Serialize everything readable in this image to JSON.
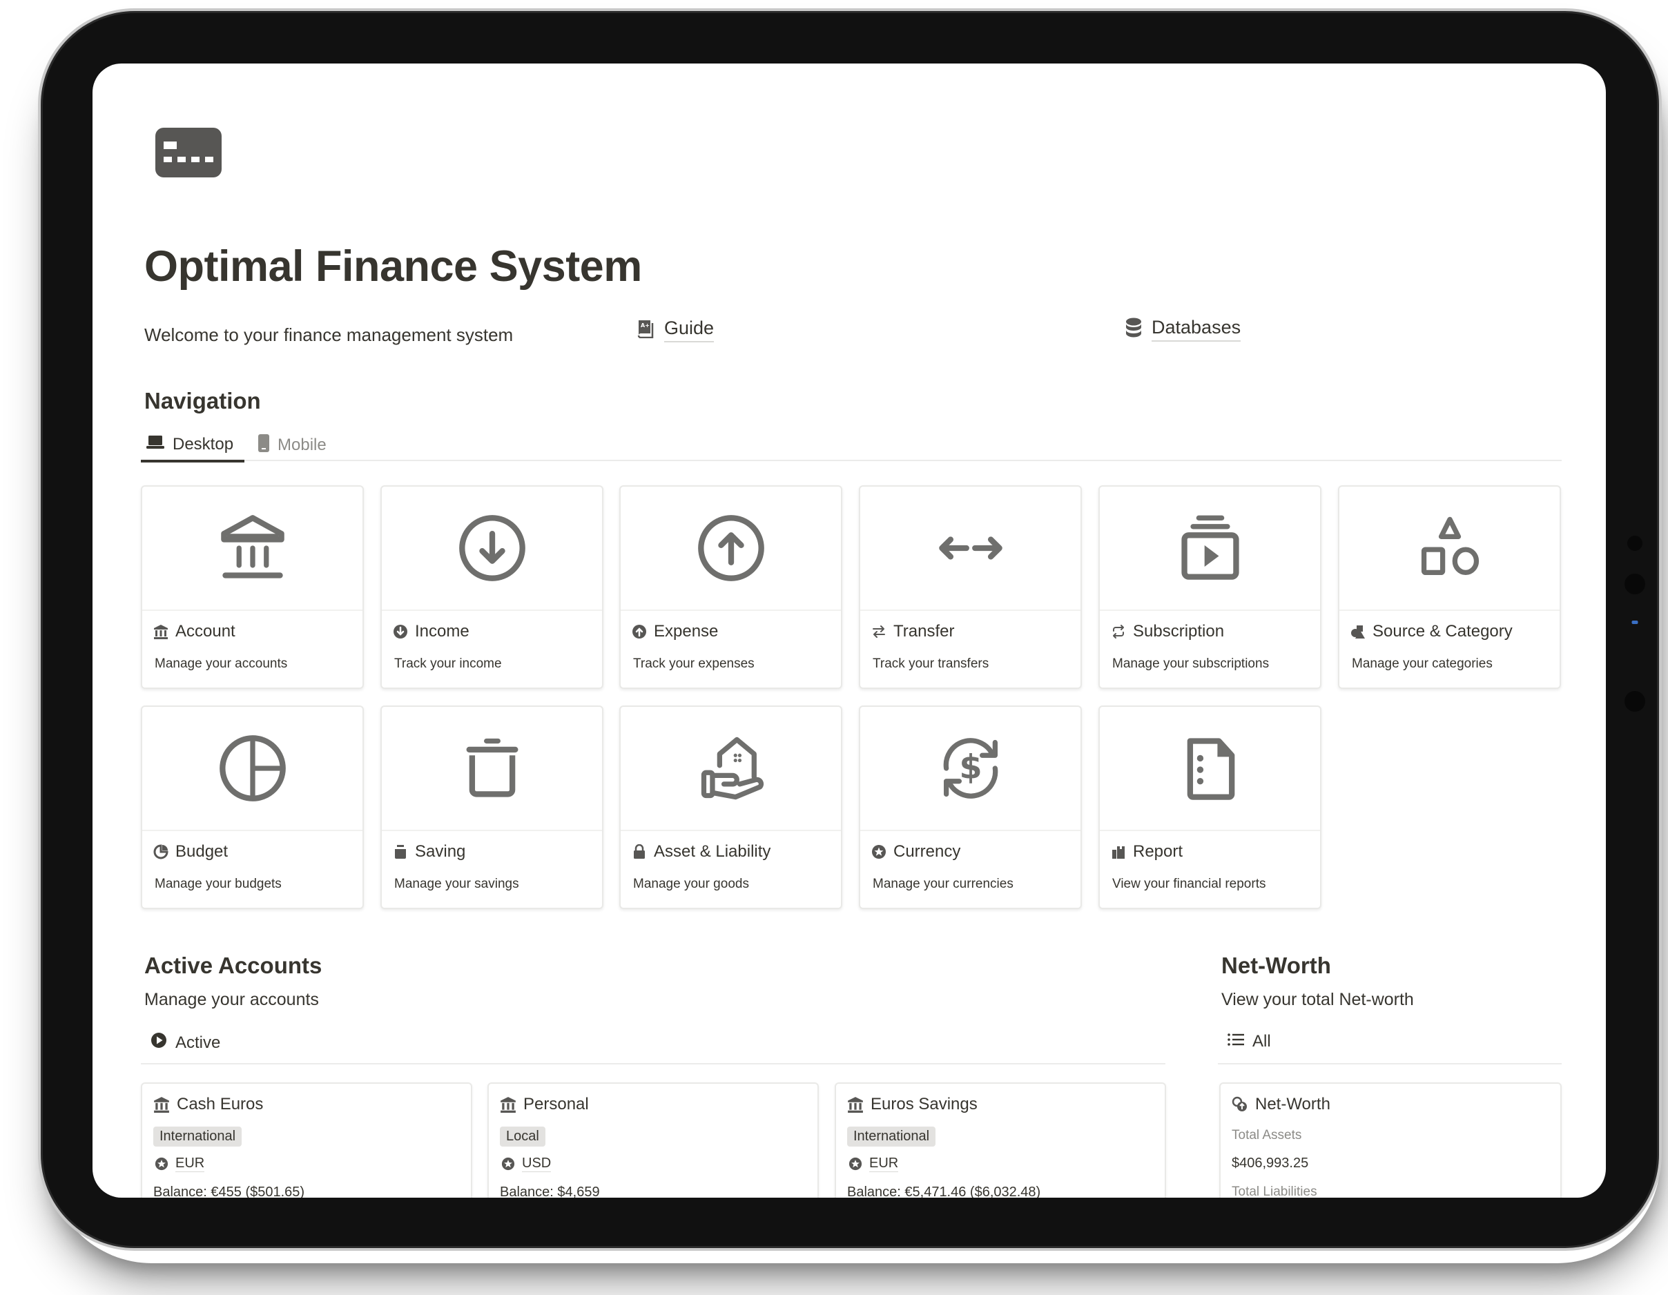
{
  "page": {
    "title": "Optimal Finance System",
    "welcome": "Welcome to your finance management system",
    "links": {
      "guide": "Guide",
      "databases": "Databases"
    }
  },
  "navigation": {
    "heading": "Navigation",
    "tabs": [
      {
        "label": "Desktop",
        "icon": "laptop-icon",
        "active": true
      },
      {
        "label": "Mobile",
        "icon": "phone-icon",
        "active": false
      }
    ],
    "cards": [
      {
        "name": "Account",
        "desc": "Manage your accounts",
        "icon": "bank-icon"
      },
      {
        "name": "Income",
        "desc": "Track your income",
        "icon": "arrow-down-circle-icon"
      },
      {
        "name": "Expense",
        "desc": "Track your expenses",
        "icon": "arrow-up-circle-icon"
      },
      {
        "name": "Transfer",
        "desc": "Track your transfers",
        "icon": "arrows-left-right-icon"
      },
      {
        "name": "Subscription",
        "desc": "Manage your subscriptions",
        "icon": "play-stack-icon"
      },
      {
        "name": "Source & Category",
        "desc": "Manage your categories",
        "icon": "shapes-icon"
      },
      {
        "name": "Budget",
        "desc": "Manage your budgets",
        "icon": "pie-chart-icon"
      },
      {
        "name": "Saving",
        "desc": "Manage your savings",
        "icon": "jar-icon"
      },
      {
        "name": "Asset & Liability",
        "desc": "Manage your goods",
        "icon": "hand-house-icon"
      },
      {
        "name": "Currency",
        "desc": "Manage your currencies",
        "icon": "currency-exchange-icon"
      },
      {
        "name": "Report",
        "desc": "View your financial reports",
        "icon": "document-icon"
      }
    ]
  },
  "active_accounts": {
    "heading": "Active Accounts",
    "subtitle": "Manage your accounts",
    "view": "Active",
    "accounts": [
      {
        "name": "Cash Euros",
        "type": "International",
        "currency": "EUR",
        "balance": "Balance: €455 ($501.65)"
      },
      {
        "name": "Personal",
        "type": "Local",
        "currency": "USD",
        "balance": "Balance: $4,659"
      },
      {
        "name": "Euros Savings",
        "type": "International",
        "currency": "EUR",
        "balance": "Balance: €5,471.46 ($6,032.48)"
      }
    ]
  },
  "net_worth": {
    "heading": "Net-Worth",
    "subtitle": "View your total Net-worth",
    "view": "All",
    "card": {
      "name": "Net-Worth",
      "total_assets_label": "Total Assets",
      "total_assets_value": "$406,993.25",
      "total_liabilities_label": "Total Liabilities"
    }
  },
  "colors": {
    "text": "#37352f",
    "muted": "#8c8b87",
    "icon": "#6f6f6d",
    "tag_bg": "#e3e2e0",
    "bezel": "#111111"
  }
}
